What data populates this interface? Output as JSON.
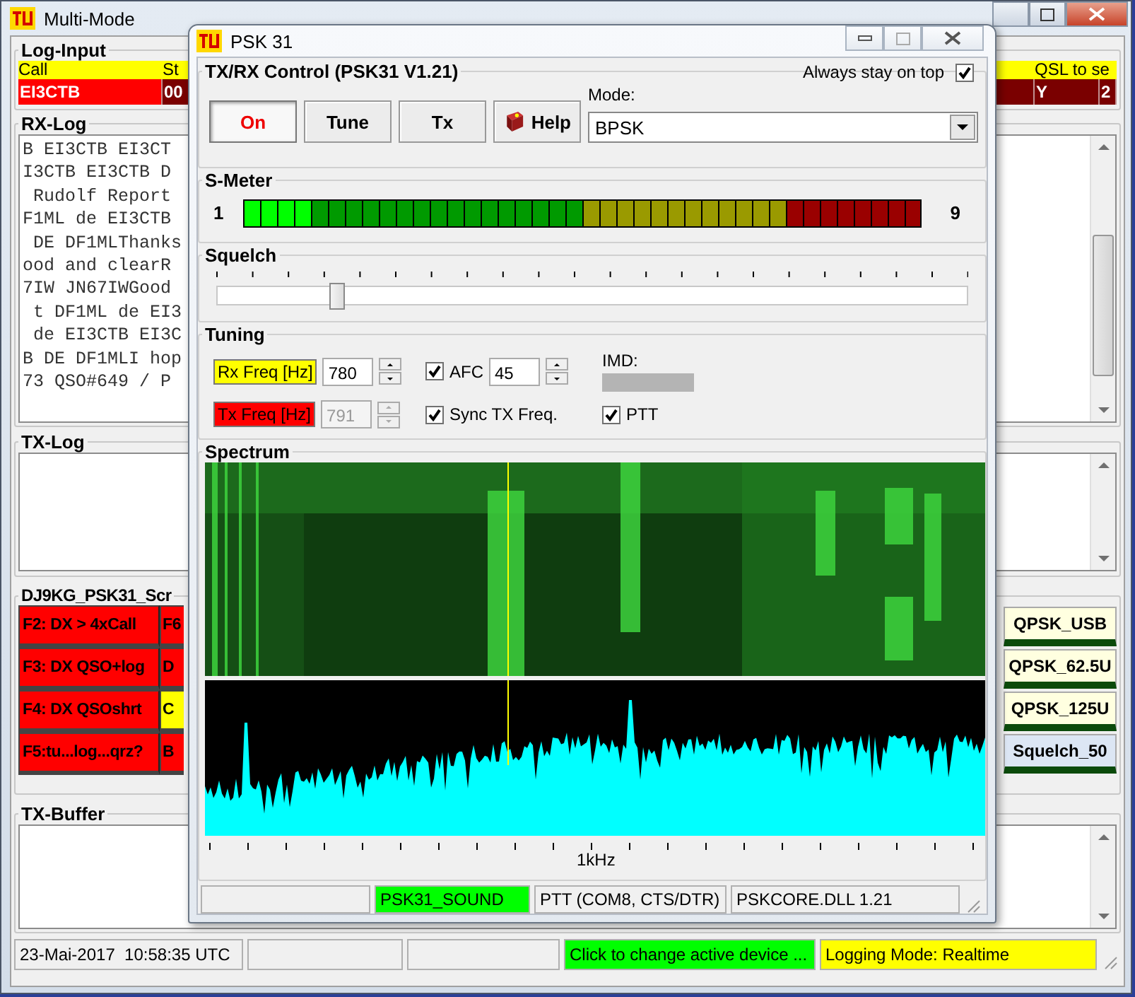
{
  "main_window": {
    "title": "Multi-Mode",
    "log_input": {
      "title": "Log-Input",
      "columns": [
        "Call",
        "St",
        "QSL to se"
      ],
      "row": [
        "EI3CTB",
        "00",
        "Y",
        "2"
      ]
    },
    "rx_log": {
      "title": "RX-Log",
      "lines": [
        "B EI3CTB EI3CT",
        "I3CTB EI3CTB D",
        " Rudolf Report",
        "F1ML de EI3CTB",
        " DE DF1MLThanks",
        "ood and clearR",
        "7IW JN67IWGood",
        " t DF1ML de EI3",
        " de EI3CTB EI3C",
        "B DE DF1MLI hop",
        "73 QSO#649 / P"
      ]
    },
    "tx_log": {
      "title": "TX-Log"
    },
    "scripts": {
      "title": "DJ9KG_PSK31_Scr",
      "rows": [
        {
          "main": {
            "label": "F2: DX > 4xCall",
            "color": "#ff0000"
          },
          "second": {
            "label": "F6",
            "color": "#ff0000"
          },
          "right": {
            "label": "QPSK_USB",
            "color": "#ffffe0"
          }
        },
        {
          "main": {
            "label": "F3: DX QSO+log",
            "color": "#ff0000"
          },
          "second": {
            "label": "D",
            "color": "#ff0000"
          },
          "right": {
            "label": "QPSK_62.5U",
            "color": "#ffffe0"
          }
        },
        {
          "main": {
            "label": "F4: DX QSOshrt",
            "color": "#ff0000"
          },
          "second": {
            "label": "C",
            "color": "#ffff00"
          },
          "right": {
            "label": "QPSK_125U",
            "color": "#ffffe0"
          }
        },
        {
          "main": {
            "label": "F5:tu...log...qrz?",
            "color": "#ff0000"
          },
          "second": {
            "label": "B",
            "color": "#ff0000"
          },
          "right": {
            "label": "Squelch_50",
            "color": "#dce6f4"
          }
        }
      ]
    },
    "tx_buffer": {
      "title": "TX-Buffer"
    },
    "status_bar": [
      {
        "text": "23-Mai-2017  10:58:35 UTC",
        "color": "#f0f0f0"
      },
      {
        "text": "Click to change active device ...",
        "color": "#00ff00"
      },
      {
        "text": "Logging Mode: Realtime",
        "color": "#ffff00"
      }
    ]
  },
  "psk_window": {
    "title": "PSK 31",
    "control": {
      "title": "TX/RX Control  (PSK31 V1.21)",
      "always_on_top": {
        "label": "Always stay on top",
        "checked": true
      },
      "buttons": [
        {
          "label": "On",
          "kind": "power",
          "selected": true
        },
        {
          "label": "Tune",
          "kind": "plain",
          "selected": false
        },
        {
          "label": "Tx",
          "kind": "plain",
          "selected": false
        },
        {
          "label": "Help",
          "kind": "help",
          "selected": false
        }
      ],
      "mode": {
        "label": "Mode:",
        "value": "BPSK"
      }
    },
    "s_meter": {
      "title": "S-Meter",
      "min_label": "1",
      "max_label": "9",
      "level": 0.1
    },
    "squelch": {
      "title": "Squelch",
      "level": 0.16
    },
    "tuning": {
      "title": "Tuning",
      "rx_freq": {
        "label": "Rx Freq [Hz]",
        "color": "#ffff00",
        "value": "780",
        "disabled": false
      },
      "tx_freq": {
        "label": "Tx Freq [Hz]",
        "color": "#ff0000",
        "value": "791",
        "disabled": true
      },
      "afc": {
        "label": "AFC",
        "checked": true,
        "value": "45"
      },
      "sync_tx": {
        "label": "Sync TX Freq.",
        "checked": true
      },
      "imd": {
        "label": "IMD:"
      },
      "ptt": {
        "label": "PTT",
        "checked": true
      }
    },
    "spectrum": {
      "title": "Spectrum",
      "axis_label": "1kHz"
    },
    "status_bar": [
      {
        "text": "PSK31_SOUND",
        "color": "#00ff00"
      },
      {
        "text": "PTT (COM8, CTS/DTR)",
        "color": "#f0f0f0"
      },
      {
        "text": "PSKCORE.DLL 1.21",
        "color": "#f0f0f0"
      }
    ]
  }
}
